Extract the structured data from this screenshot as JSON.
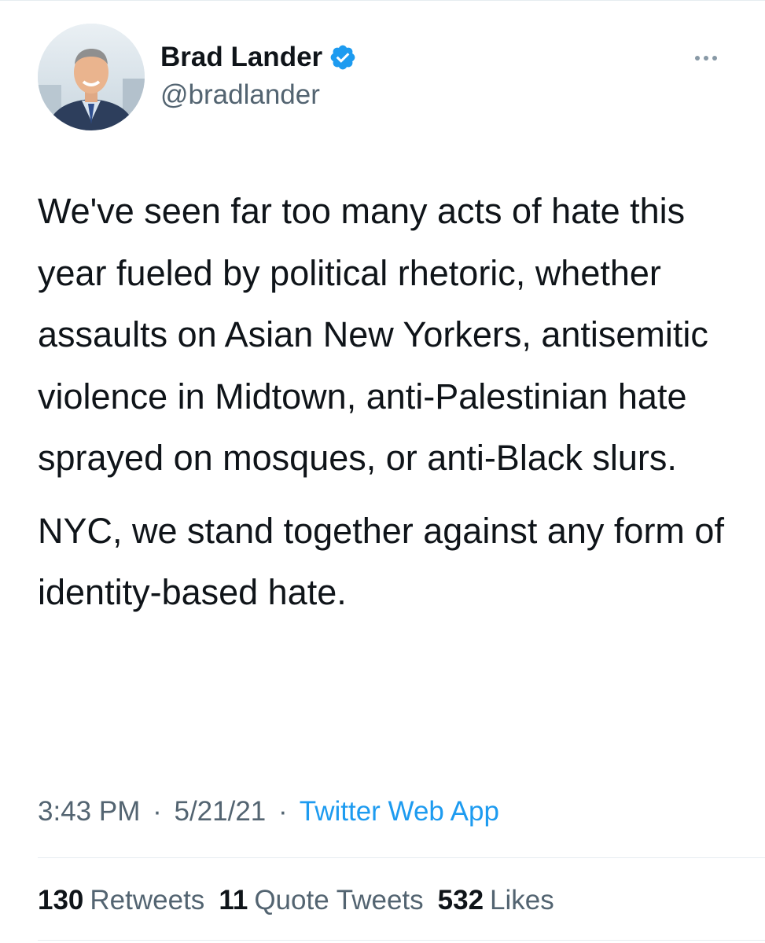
{
  "author": {
    "display_name": "Brad Lander",
    "handle": "@bradlander",
    "verified_icon": "verified-badge-icon",
    "verified_color": "#1d9bf0"
  },
  "tweet": {
    "paragraphs": [
      "We've seen far too many acts of hate this year fueled by political rhetoric, whether assaults on Asian New Yorkers, antisemitic violence in Midtown, anti-Palestinian hate sprayed on mosques, or anti-Black slurs.",
      "NYC, we stand together against any form of identity-based hate."
    ],
    "time": "3:43 PM",
    "separator": "·",
    "date": "5/21/21",
    "source": "Twitter Web App"
  },
  "stats": {
    "retweets_count": "130",
    "retweets_label": "Retweets",
    "quotes_count": "11",
    "quotes_label": "Quote Tweets",
    "likes_count": "532",
    "likes_label": "Likes"
  },
  "colors": {
    "text_primary": "#0f1419",
    "text_secondary": "#536471",
    "link": "#1d9bf0",
    "divider": "#e6ecf0"
  }
}
